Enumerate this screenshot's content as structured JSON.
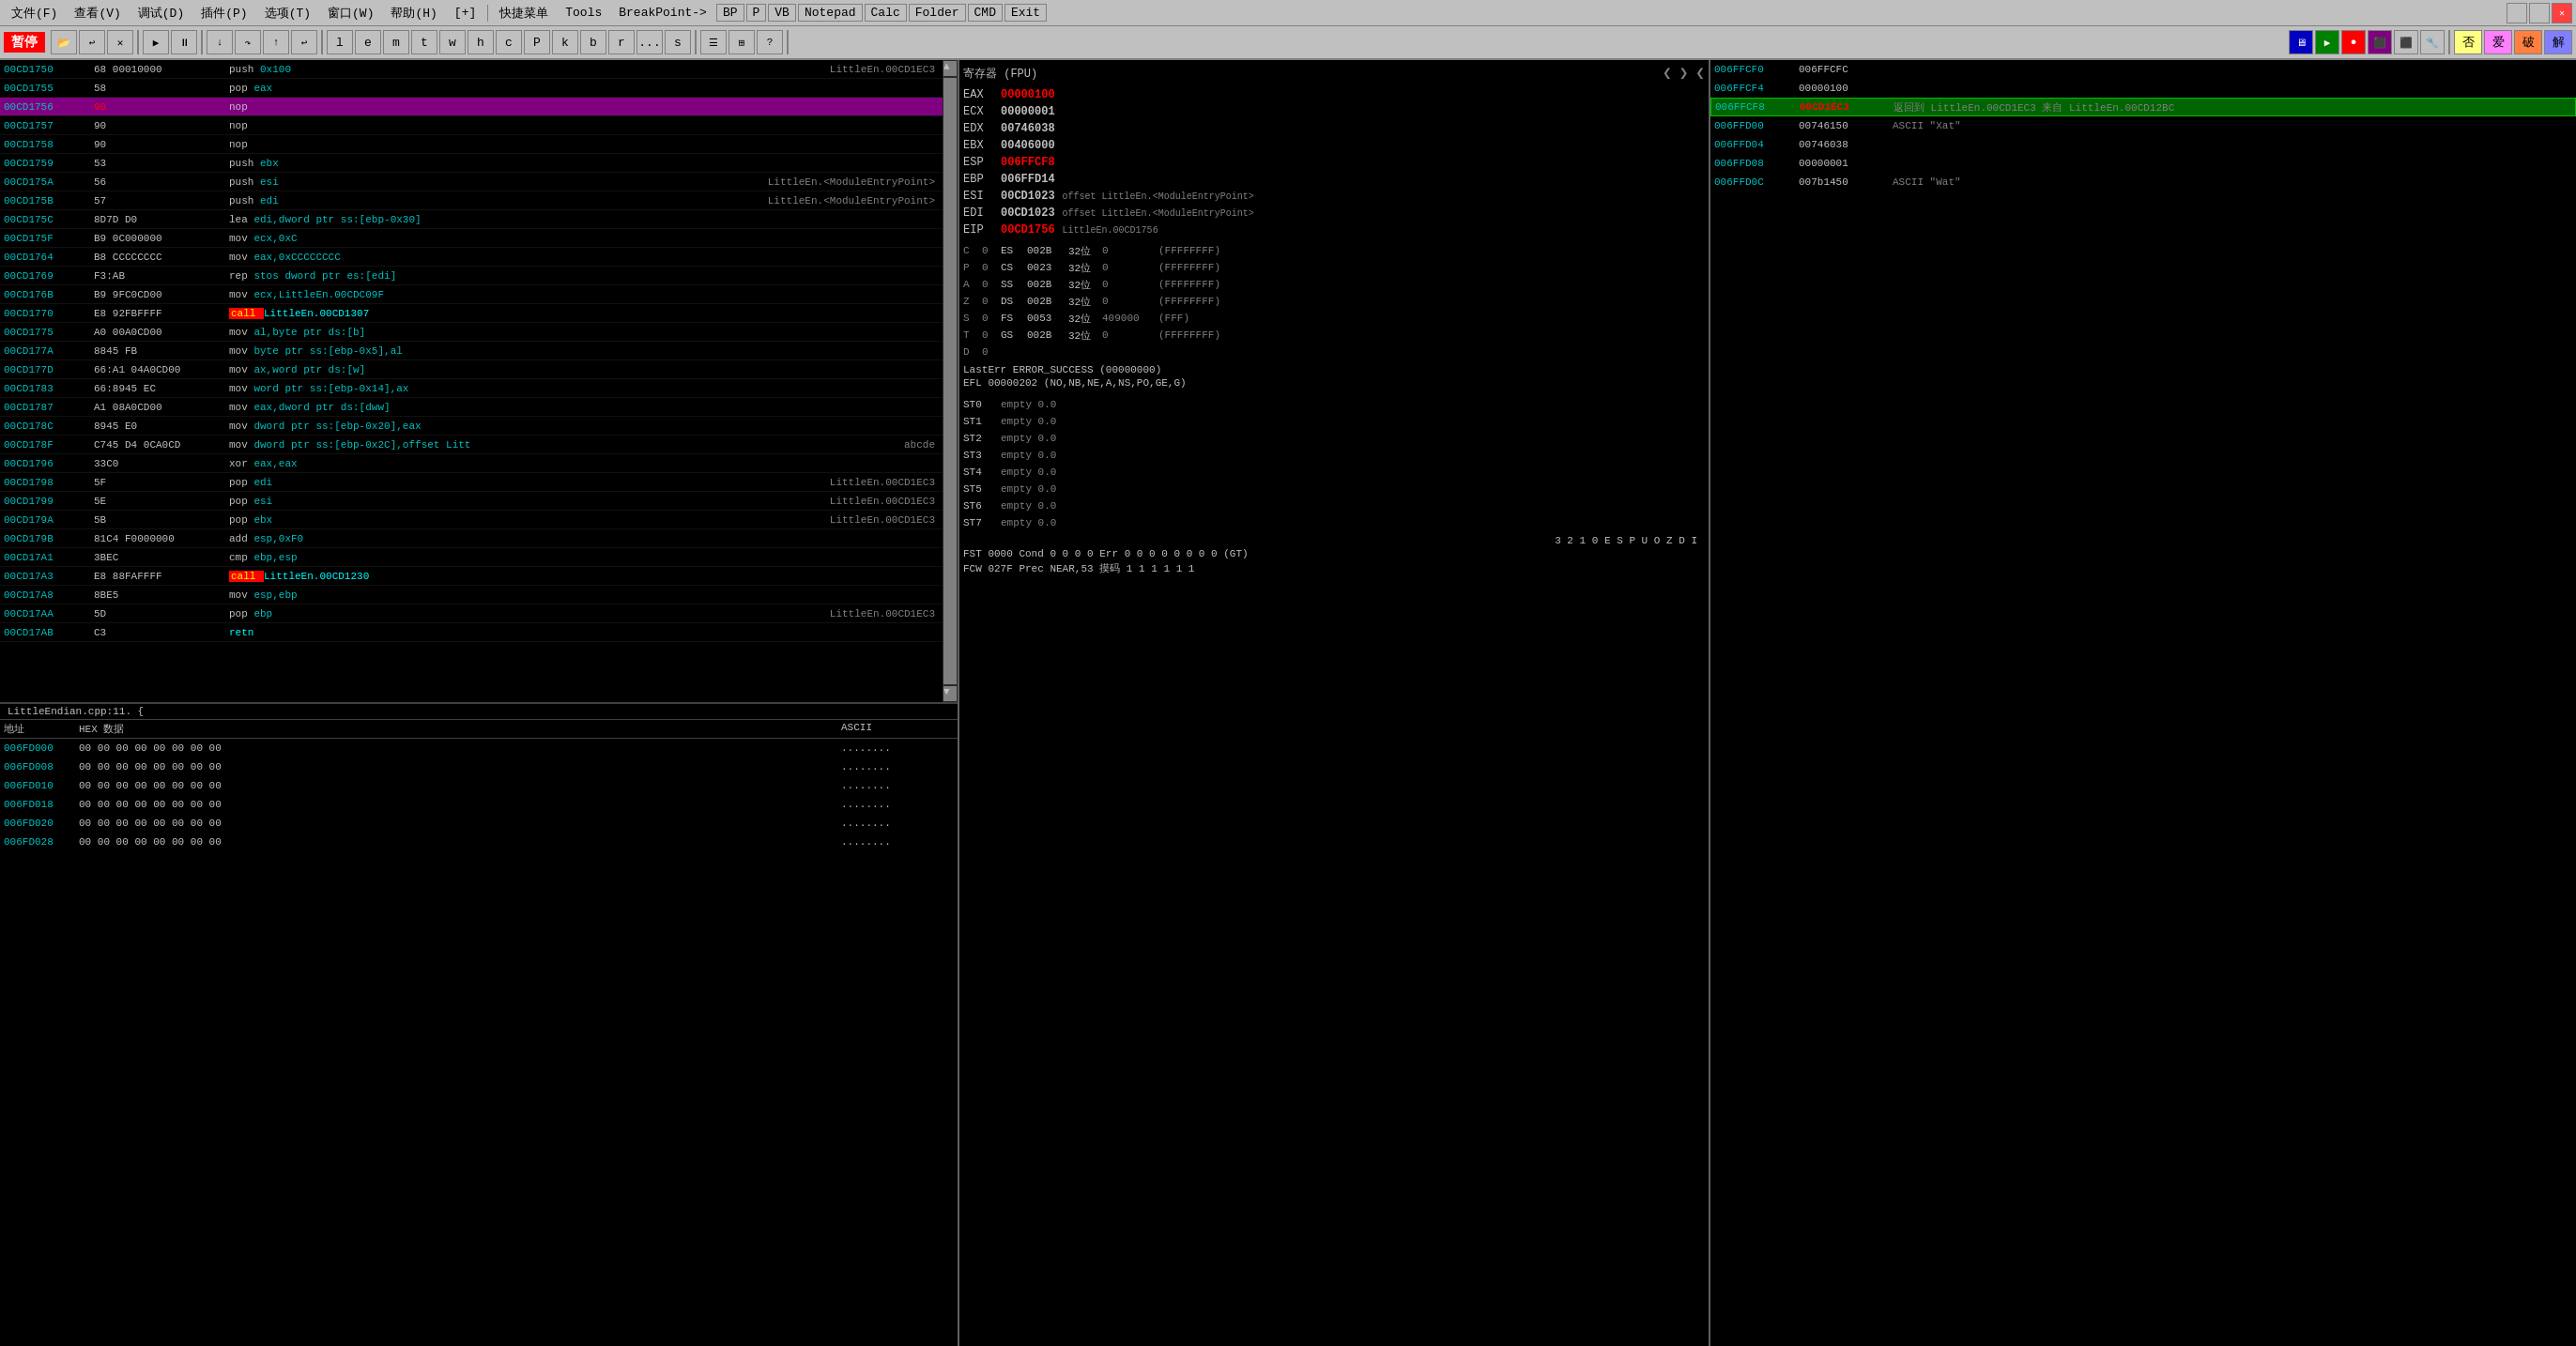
{
  "menubar": {
    "items": [
      {
        "label": "文件(F)"
      },
      {
        "label": "查看(V)"
      },
      {
        "label": "调试(D)"
      },
      {
        "label": "插件(P)"
      },
      {
        "label": "选项(T)"
      },
      {
        "label": "窗口(W)"
      },
      {
        "label": "帮助(H)"
      },
      {
        "label": "[+]"
      },
      {
        "label": "快捷菜单"
      },
      {
        "label": "Tools"
      },
      {
        "label": "BreakPoint->"
      },
      {
        "label": "BP"
      },
      {
        "label": "P"
      },
      {
        "label": "VB"
      },
      {
        "label": "Notepad"
      },
      {
        "label": "Calc"
      },
      {
        "label": "Folder"
      },
      {
        "label": "CMD"
      },
      {
        "label": "Exit"
      }
    ]
  },
  "toolbar": {
    "stop_label": "暂停",
    "win_min": "－",
    "win_restore": "口",
    "win_close": "✕"
  },
  "reg_panel": {
    "title": "寄存器 (FPU)",
    "registers": [
      {
        "name": "EAX",
        "value": "00000100",
        "highlighted": true,
        "extra": ""
      },
      {
        "name": "ECX",
        "value": "00000001",
        "highlighted": false,
        "extra": ""
      },
      {
        "name": "EDX",
        "value": "00746038",
        "highlighted": false,
        "extra": ""
      },
      {
        "name": "EBX",
        "value": "00406000",
        "highlighted": false,
        "extra": ""
      },
      {
        "name": "ESP",
        "value": "006FFCF8",
        "highlighted": true,
        "extra": ""
      },
      {
        "name": "EBP",
        "value": "006FFD14",
        "highlighted": false,
        "extra": ""
      },
      {
        "name": "ESI",
        "value": "00CD1023",
        "highlighted": false,
        "extra": "offset LittleEn.<ModuleEntryPoint>"
      },
      {
        "name": "EDI",
        "value": "00CD1023",
        "highlighted": false,
        "extra": "offset LittleEn.<ModuleEntryPoint>"
      },
      {
        "name": "EIP",
        "value": "00CD1756",
        "highlighted": true,
        "extra": "LittleEn.00CD1756"
      }
    ],
    "flags": [
      {
        "flag": "C",
        "val": "0",
        "name": "ES",
        "num": "002B",
        "bits": "32位",
        "pos": "0",
        "range": "(FFFFFFFF)"
      },
      {
        "flag": "P",
        "val": "0",
        "name": "CS",
        "num": "0023",
        "bits": "32位",
        "pos": "0",
        "range": "(FFFFFFFF)"
      },
      {
        "flag": "A",
        "val": "0",
        "name": "SS",
        "num": "002B",
        "bits": "32位",
        "pos": "0",
        "range": "(FFFFFFFF)"
      },
      {
        "flag": "Z",
        "val": "0",
        "name": "DS",
        "num": "002B",
        "bits": "32位",
        "pos": "0",
        "range": "(FFFFFFFF)"
      },
      {
        "flag": "S",
        "val": "0",
        "name": "FS",
        "num": "0053",
        "bits": "32位",
        "pos": "409000",
        "range": "(FFF)"
      },
      {
        "flag": "T",
        "val": "0",
        "name": "GS",
        "num": "002B",
        "bits": "32位",
        "pos": "0",
        "range": "(FFFFFFFF)"
      },
      {
        "flag": "D",
        "val": "0",
        "name": "",
        "num": "",
        "bits": "",
        "pos": "",
        "range": ""
      }
    ],
    "last_err": "LastErr ERROR_SUCCESS (00000000)",
    "efl": "EFL 00000202 (NO,NB,NE,A,NS,PO,GE,G)",
    "fpu_regs": [
      {
        "name": "ST0",
        "val": "empty 0.0"
      },
      {
        "name": "ST1",
        "val": "empty 0.0"
      },
      {
        "name": "ST2",
        "val": "empty 0.0"
      },
      {
        "name": "ST3",
        "val": "empty 0.0"
      },
      {
        "name": "ST4",
        "val": "empty 0.0"
      },
      {
        "name": "ST5",
        "val": "empty 0.0"
      },
      {
        "name": "ST6",
        "val": "empty 0.0"
      },
      {
        "name": "ST7",
        "val": "empty 0.0"
      }
    ],
    "fpu_status": "3 2 1 0    E S P U O Z D I",
    "fst": "FST 0000  Cond 0 0 0 0  Err 0 0 0 0 0 0 0 0  (GT)",
    "fcw": "FCW 027F  Prec NEAR,53  摸码    1 1 1 1 1 1"
  },
  "disasm": {
    "rows": [
      {
        "addr": "00CD1750",
        "hex": "68 00010000",
        "instr": "push 0x100",
        "comment": "LittleEn.00CD1EC3",
        "style": "normal"
      },
      {
        "addr": "00CD1755",
        "hex": "58",
        "instr": "pop eax",
        "comment": "",
        "style": "normal"
      },
      {
        "addr": "00CD1756",
        "hex": "90",
        "instr": "nop",
        "comment": "",
        "style": "current"
      },
      {
        "addr": "00CD1757",
        "hex": "90",
        "instr": "nop",
        "comment": "",
        "style": "normal"
      },
      {
        "addr": "00CD1758",
        "hex": "90",
        "instr": "nop",
        "comment": "",
        "style": "normal"
      },
      {
        "addr": "00CD1759",
        "hex": "53",
        "instr": "push ebx",
        "comment": "",
        "style": "normal"
      },
      {
        "addr": "00CD175A",
        "hex": "56",
        "instr": "push esi",
        "comment": "LittleEn.<ModuleEntryPoint>",
        "style": "normal"
      },
      {
        "addr": "00CD175B",
        "hex": "57",
        "instr": "push edi",
        "comment": "LittleEn.<ModuleEntryPoint>",
        "style": "normal"
      },
      {
        "addr": "00CD175C",
        "hex": "8D7D D0",
        "instr": "lea edi,dword ptr ss:[ebp-0x30]",
        "comment": "",
        "style": "normal"
      },
      {
        "addr": "00CD175F",
        "hex": "B9 0C000000",
        "instr": "mov ecx,0xC",
        "comment": "",
        "style": "normal"
      },
      {
        "addr": "00CD1764",
        "hex": "B8 CCCCCCCC",
        "instr": "mov eax,0xCCCCCCCC",
        "comment": "",
        "style": "normal"
      },
      {
        "addr": "00CD1769",
        "hex": "F3:AB",
        "instr": "rep stos dword ptr es:[edi]",
        "comment": "",
        "style": "normal"
      },
      {
        "addr": "00CD176B",
        "hex": "B9 9FC0CD00",
        "instr": "mov ecx,LittleEn.00CDC09F",
        "comment": "",
        "style": "normal"
      },
      {
        "addr": "00CD1770",
        "hex": "E8 92FBFFFF",
        "instr": "call LittleEn.00CD1307",
        "comment": "",
        "style": "call"
      },
      {
        "addr": "00CD1775",
        "hex": "A0 00A0CD00",
        "instr": "mov al,byte ptr ds:[b]",
        "comment": "",
        "style": "normal"
      },
      {
        "addr": "00CD177A",
        "hex": "8845 FB",
        "instr": "mov byte ptr ss:[ebp-0x5],al",
        "comment": "",
        "style": "normal"
      },
      {
        "addr": "00CD177D",
        "hex": "66:A1 04A0CD00",
        "instr": "mov ax,word ptr ds:[w]",
        "comment": "",
        "style": "normal"
      },
      {
        "addr": "00CD1783",
        "hex": "66:8945 EC",
        "instr": "mov word ptr ss:[ebp-0x14],ax",
        "comment": "",
        "style": "normal"
      },
      {
        "addr": "00CD1787",
        "hex": "A1 08A0CD00",
        "instr": "mov eax,dword ptr ds:[dww]",
        "comment": "",
        "style": "normal"
      },
      {
        "addr": "00CD178C",
        "hex": "8945 E0",
        "instr": "mov dword ptr ss:[ebp-0x20],eax",
        "comment": "",
        "style": "normal"
      },
      {
        "addr": "00CD178F",
        "hex": "C745 D4 0CA0CD",
        "instr": "mov dword ptr ss:[ebp-0x2C],offset Litt",
        "comment": "abcde",
        "style": "normal"
      },
      {
        "addr": "00CD1796",
        "hex": "33C0",
        "instr": "xor eax,eax",
        "comment": "",
        "style": "normal"
      },
      {
        "addr": "00CD1798",
        "hex": "5F",
        "instr": "pop edi",
        "comment": "LittleEn.00CD1EC3",
        "style": "normal"
      },
      {
        "addr": "00CD1799",
        "hex": "5E",
        "instr": "pop esi",
        "comment": "LittleEn.00CD1EC3",
        "style": "normal"
      },
      {
        "addr": "00CD179A",
        "hex": "5B",
        "instr": "pop ebx",
        "comment": "LittleEn.00CD1EC3",
        "style": "normal"
      },
      {
        "addr": "00CD179B",
        "hex": "81C4 F0000000",
        "instr": "add esp,0xF0",
        "comment": "",
        "style": "normal"
      },
      {
        "addr": "00CD17A1",
        "hex": "3BEC",
        "instr": "cmp ebp,esp",
        "comment": "",
        "style": "normal"
      },
      {
        "addr": "00CD17A3",
        "hex": "E8 88FAFFFF",
        "instr": "call LittleEn.00CD1230",
        "comment": "",
        "style": "call"
      },
      {
        "addr": "00CD17A8",
        "hex": "8BE5",
        "instr": "mov esp,ebp",
        "comment": "",
        "style": "normal"
      },
      {
        "addr": "00CD17AA",
        "hex": "5D",
        "instr": "pop ebp",
        "comment": "LittleEn.00CD1EC3",
        "style": "normal"
      },
      {
        "addr": "00CD17AB",
        "hex": "C3",
        "instr": "retn",
        "comment": "",
        "style": "ret"
      }
    ]
  },
  "source": {
    "title": "LittleEndian.cpp:11.  {"
  },
  "memory": {
    "header": {
      "addr": "地址",
      "hex": "HEX 数据",
      "ascii": "ASCII"
    },
    "rows": [
      {
        "addr": "006FD000",
        "hex": "00 00 00 00 00 00 00 00",
        "ascii": "........"
      },
      {
        "addr": "006FD008",
        "hex": "00 00 00 00 00 00 00 00",
        "ascii": "........"
      },
      {
        "addr": "006FD010",
        "hex": "00 00 00 00 00 00 00 00",
        "ascii": "........"
      },
      {
        "addr": "006FD018",
        "hex": "00 00 00 00 00 00 00 00",
        "ascii": "........"
      },
      {
        "addr": "006FD020",
        "hex": "00 00 00 00 00 00 00 00",
        "ascii": "........"
      },
      {
        "addr": "006FD028",
        "hex": "00 00 00 00 00 00 00 00",
        "ascii": "........"
      }
    ]
  },
  "stack": {
    "rows": [
      {
        "addr": "006FFCF0",
        "val": "006FFCFC",
        "comment": "",
        "style": "normal"
      },
      {
        "addr": "006FFCF4",
        "val": "00000100",
        "comment": "",
        "style": "normal"
      },
      {
        "addr": "006FFCF8",
        "val": "00CD1EC3",
        "comment": "返回到 LittleEn.00CD1EC3 来自 LittleEn.00CD12BC",
        "style": "highlighted"
      },
      {
        "addr": "006FFD00",
        "val": "00746150",
        "comment": "ASCII \"Xat\"",
        "style": "normal"
      },
      {
        "addr": "006FFD04",
        "val": "00746038",
        "comment": "",
        "style": "normal"
      },
      {
        "addr": "006FFD08",
        "val": "00000001",
        "comment": "",
        "style": "normal"
      },
      {
        "addr": "006FFD0C",
        "val": "007b1450",
        "comment": "ASCII \"Wat\"",
        "style": "normal"
      }
    ]
  }
}
